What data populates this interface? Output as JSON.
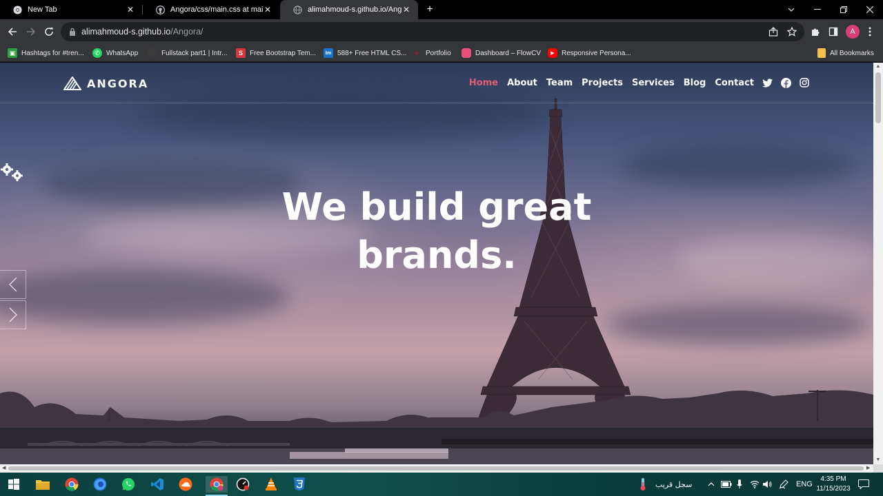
{
  "browser": {
    "tabs": [
      {
        "title": "New Tab",
        "icon": "chrome-icon",
        "active": false
      },
      {
        "title": "Angora/css/main.css at main · al",
        "icon": "github-icon",
        "active": false
      },
      {
        "title": "alimahmoud-s.github.io/Angora",
        "icon": "globe-icon",
        "active": true
      }
    ],
    "new_tab_label": "+",
    "url_host": "alimahmoud-s.github.io",
    "url_path": "/Angora/",
    "profile_initial": "A",
    "bookmarks": [
      {
        "label": "Hashtags for #tren...",
        "icon": "image-icon",
        "color": "#2e9e44"
      },
      {
        "label": "WhatsApp",
        "icon": "whatsapp-icon",
        "color": "#25d366"
      },
      {
        "label": "Fullstack part1 | Intr...",
        "icon": "dark-site-icon",
        "color": "#3a3a3a"
      },
      {
        "label": "Free Bootstrap Tem...",
        "icon": "s-letter-icon",
        "color": "#d6373f"
      },
      {
        "label": "588+ Free HTML CS...",
        "icon": "tm-icon",
        "color": "#1a73c9"
      },
      {
        "label": "Portfolio",
        "icon": "star-icon",
        "color": "#8b1e2e"
      },
      {
        "label": "Dashboard – FlowCV",
        "icon": "flowcv-icon",
        "color": "#e94f7a"
      },
      {
        "label": "Responsive Persona...",
        "icon": "youtube-icon",
        "color": "#ff0000"
      }
    ],
    "all_bookmarks_label": "All Bookmarks"
  },
  "site": {
    "logo_text": "ANGORA",
    "nav": [
      "Home",
      "About",
      "Team",
      "Projects",
      "Services",
      "Blog",
      "Contact"
    ],
    "active_nav": "Home",
    "social": [
      "twitter-icon",
      "facebook-icon",
      "instagram-icon"
    ],
    "hero_line1": "We build great",
    "hero_line2": "brands.",
    "accent_color": "#e45c72"
  },
  "taskbar": {
    "apps": [
      "start-icon",
      "file-explorer-icon",
      "chrome-icon",
      "firefox-icon",
      "whatsapp-icon",
      "vscode-icon",
      "cloud-app-icon",
      "chrome-profile-icon",
      "speed-icon",
      "vlc-icon",
      "css3-icon"
    ],
    "weather_text": "سجل قريب",
    "lang": "ENG",
    "time": "4:35 PM",
    "date": "11/15/2023"
  }
}
